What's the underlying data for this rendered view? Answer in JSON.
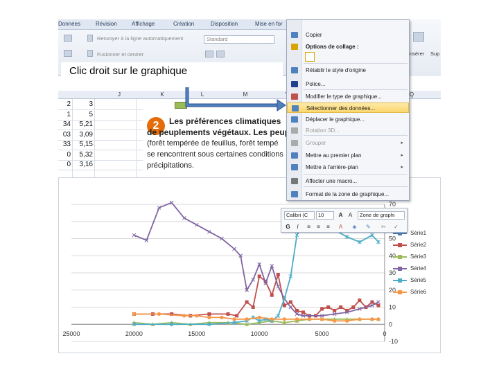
{
  "caption": "Clic droit sur le graphique",
  "ribbon": {
    "tabs": [
      "Données",
      "Révision",
      "Affichage",
      "Création",
      "Disposition",
      "Mise en for"
    ],
    "row1_label": "Renvoyer à la ligne automatiquement",
    "row2_label": "Fusionner et centrer",
    "number_format": "Standard",
    "right_labels": [
      "nsérer",
      "Sup"
    ]
  },
  "sheet": {
    "columns": [
      "J",
      "K",
      "L",
      "M",
      "Y",
      "Q"
    ],
    "col_left_values": [
      "2",
      "1",
      "34",
      "03",
      "33",
      "0",
      "0"
    ],
    "col_right_values": [
      "3",
      "5",
      "5,21",
      "3,09",
      "5,15",
      "5,32",
      "3,16"
    ]
  },
  "card": {
    "badge": "2",
    "lines": [
      "Les préférences climatiques",
      "de peuplements végétaux. Les peup",
      "(forêt tempérée de feuillus, forêt tempé",
      "se rencontrent sous certaines conditions",
      "précipitations."
    ]
  },
  "menu": {
    "items": [
      {
        "label": "Copier",
        "icon": "copy-icon",
        "disabled": false
      },
      {
        "label": "Options de collage :",
        "icon": "paste-icon",
        "disabled": false,
        "bold": true
      },
      {
        "label": "Rétablir le style d'origine",
        "icon": "reset-style-icon",
        "disabled": false
      },
      {
        "label": "Police...",
        "icon": "font-icon",
        "disabled": false
      },
      {
        "label": "Modifier le type de graphique...",
        "icon": "chart-type-icon",
        "disabled": false
      },
      {
        "label": "Sélectionner des données...",
        "icon": "select-data-icon",
        "disabled": false,
        "highlight": true
      },
      {
        "label": "Déplacer le graphique...",
        "icon": "move-chart-icon",
        "disabled": false
      },
      {
        "label": "Rotation 3D...",
        "icon": "rotation-3d-icon",
        "disabled": true
      },
      {
        "label": "Grouper",
        "icon": "group-icon",
        "disabled": true,
        "submenu": true
      },
      {
        "label": "Mettre au premier plan",
        "icon": "bring-front-icon",
        "disabled": false,
        "submenu": true
      },
      {
        "label": "Mettre à l'arrière-plan",
        "icon": "send-back-icon",
        "disabled": false,
        "submenu": true
      },
      {
        "label": "Affecter une macro...",
        "icon": "macro-icon",
        "disabled": false
      },
      {
        "label": "Format de la zone de graphique...",
        "icon": "format-chart-area-icon",
        "disabled": false
      }
    ]
  },
  "minitoolbar": {
    "font": "Calibri (C",
    "size": "10",
    "zone": "Zone de graphi"
  },
  "colors": {
    "series1": "#4f81bd",
    "series2": "#c0504d",
    "series3": "#9bbb59",
    "series4": "#8064a2",
    "series5": "#4bacc6",
    "series6": "#f79646",
    "highlight": "#fbd66e",
    "badge": "#e46c0a"
  },
  "chart_data": {
    "type": "line",
    "title": "",
    "xlabel": "",
    "ylabel": "",
    "x_ticks": [
      25000,
      20000,
      15000,
      10000,
      5000,
      0
    ],
    "y_ticks": [
      70,
      60,
      50,
      40,
      30,
      20,
      10,
      0,
      -10
    ],
    "xlim": [
      25000,
      0
    ],
    "ylim": [
      -10,
      70
    ],
    "grid": true,
    "legend": "right",
    "series": [
      {
        "name": "Série1",
        "x": [],
        "values": []
      },
      {
        "name": "Série2",
        "x": [
          20000,
          18500,
          17000,
          15500,
          14000,
          12500,
          11800,
          11000,
          10500,
          10000,
          9500,
          9000,
          8500,
          8000,
          7500,
          7000,
          6500,
          6000,
          5500,
          5000,
          4500,
          4000,
          3500,
          3000,
          2500,
          2000,
          1500,
          1000,
          500
        ],
        "values": [
          6,
          6,
          6,
          5,
          6,
          6,
          5,
          13,
          10,
          28,
          25,
          17,
          29,
          11,
          13,
          8,
          7,
          5,
          5,
          9,
          10,
          8,
          10,
          8,
          10,
          14,
          10,
          13,
          11
        ]
      },
      {
        "name": "Série3",
        "x": [
          20000,
          18500,
          17000,
          15500,
          14000,
          12500,
          11000,
          10000,
          9000,
          8000,
          7000,
          6000,
          5000,
          4000,
          3000,
          2000,
          1000,
          500
        ],
        "values": [
          1,
          0,
          1,
          0,
          1,
          1,
          0,
          1,
          2,
          1,
          2,
          3,
          3,
          3,
          3,
          3,
          3,
          3
        ]
      },
      {
        "name": "Série4",
        "x": [
          20000,
          19000,
          18000,
          17000,
          16000,
          15000,
          14000,
          13000,
          12000,
          11500,
          11000,
          10500,
          10000,
          9500,
          9000,
          8500,
          8000,
          7500,
          7000,
          6500,
          6000,
          5000,
          4000,
          3000,
          2000,
          1000,
          500
        ],
        "values": [
          52,
          49,
          68,
          71,
          62,
          58,
          54,
          50,
          44,
          40,
          20,
          26,
          35,
          24,
          34,
          22,
          15,
          10,
          6,
          5,
          5,
          5,
          6,
          7,
          9,
          11,
          13
        ]
      },
      {
        "name": "Série5",
        "x": [
          20000,
          17000,
          14000,
          12000,
          11000,
          10500,
          10000,
          9500,
          9000,
          8500,
          8000,
          7500,
          7000,
          6500,
          6000,
          5500,
          5000,
          4500,
          4000,
          3000,
          2000,
          1000,
          500
        ],
        "values": [
          0,
          0,
          0,
          1,
          2,
          4,
          2,
          3,
          2,
          5,
          15,
          28,
          52,
          59,
          63,
          60,
          61,
          56,
          55,
          51,
          48,
          52,
          48
        ]
      },
      {
        "name": "Série6",
        "x": [
          20000,
          18000,
          16000,
          15000,
          14000,
          13000,
          12000,
          11000,
          10000,
          9000,
          8000,
          7000,
          6000,
          5000,
          4000,
          3000,
          2000,
          1000,
          500
        ],
        "values": [
          6,
          6,
          5,
          5,
          4,
          4,
          3,
          3,
          4,
          3,
          3,
          3,
          3,
          3,
          2,
          2,
          3,
          3,
          3
        ]
      }
    ]
  }
}
